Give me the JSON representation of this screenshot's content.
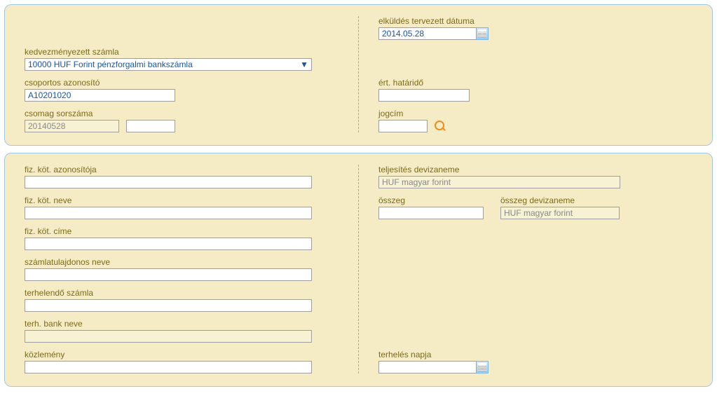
{
  "top": {
    "beneficiary_account_label": "kedvezményezett számla",
    "beneficiary_account_value": "10000 HUF Forint pénzforgalmi bankszámla",
    "group_id_label": "csoportos azonosító",
    "group_id_value": "A10201020",
    "package_seq_label": "csomag sorszáma",
    "package_seq_value": "20140528",
    "package_seq2_value": "",
    "send_date_label": "elküldés tervezett dátuma",
    "send_date_value": "2014.05.28",
    "deadline_label": "ért. határidő",
    "deadline_value": "",
    "title_label": "jogcím",
    "title_value": ""
  },
  "bottom": {
    "payer_id_label": "fiz. köt. azonosítója",
    "payer_id_value": "",
    "payer_name_label": "fiz. köt. neve",
    "payer_name_value": "",
    "payer_addr_label": "fiz. köt. címe",
    "payer_addr_value": "",
    "owner_name_label": "számlatulajdonos neve",
    "owner_name_value": "",
    "debit_account_label": "terhelendő számla",
    "debit_account_value": "",
    "debit_bank_label": "terh. bank neve",
    "debit_bank_value": "",
    "memo_label": "közlemény",
    "memo_value": "",
    "perf_currency_label": "teljesítés devizaneme",
    "perf_currency_value": "HUF magyar forint",
    "amount_label": "összeg",
    "amount_value": "",
    "amount_currency_label": "összeg devizaneme",
    "amount_currency_value": "HUF magyar forint",
    "debit_date_label": "terhelés napja",
    "debit_date_value": ""
  }
}
